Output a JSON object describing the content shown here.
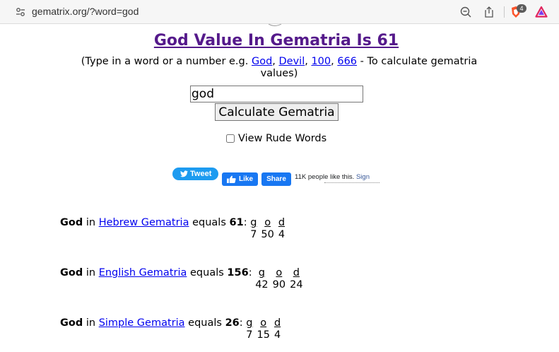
{
  "browser": {
    "url": "gematrix.org/?word=god",
    "badge_count": "4",
    "icons": [
      "site-settings-icon",
      "zoom-icon",
      "share-icon",
      "brave-shields-icon",
      "brave-rewards-icon"
    ]
  },
  "page": {
    "title": "God Value In Gematria Is 61",
    "instructions_prefix": "(Type in a word or a number e.g. ",
    "example_links": [
      "God",
      "Devil",
      "100",
      "666"
    ],
    "instructions_suffix": " - To calculate gematria values)",
    "input_value": "god",
    "calculate_button": "Calculate Gematria",
    "rude_words_label": "View Rude Words",
    "rude_words_checked": false
  },
  "social": {
    "tweet_label": "Tweet",
    "like_label": "Like",
    "share_label": "Share",
    "like_count_text": "11K people like this.",
    "sign_link": "Sign"
  },
  "results": [
    {
      "word": "God",
      "in_text": "in",
      "cipher": "Hebrew Gematria",
      "equals_text": "equals",
      "total": "61",
      "letters": [
        "g",
        "o",
        "d"
      ],
      "values": [
        "7",
        "50",
        "4"
      ]
    },
    {
      "word": "God",
      "in_text": "in",
      "cipher": "English Gematria",
      "equals_text": "equals",
      "total": "156",
      "letters": [
        "g",
        "o",
        "d"
      ],
      "values": [
        "42",
        "90",
        "24"
      ]
    },
    {
      "word": "God",
      "in_text": "in",
      "cipher": "Simple Gematria",
      "equals_text": "equals",
      "total": "26",
      "letters": [
        "g",
        "o",
        "d"
      ],
      "values": [
        "7",
        "15",
        "4"
      ]
    }
  ],
  "colors": {
    "title": "#551a8b",
    "link": "#0000ee",
    "twitter": "#1d9bf0",
    "facebook": "#1877f2"
  }
}
